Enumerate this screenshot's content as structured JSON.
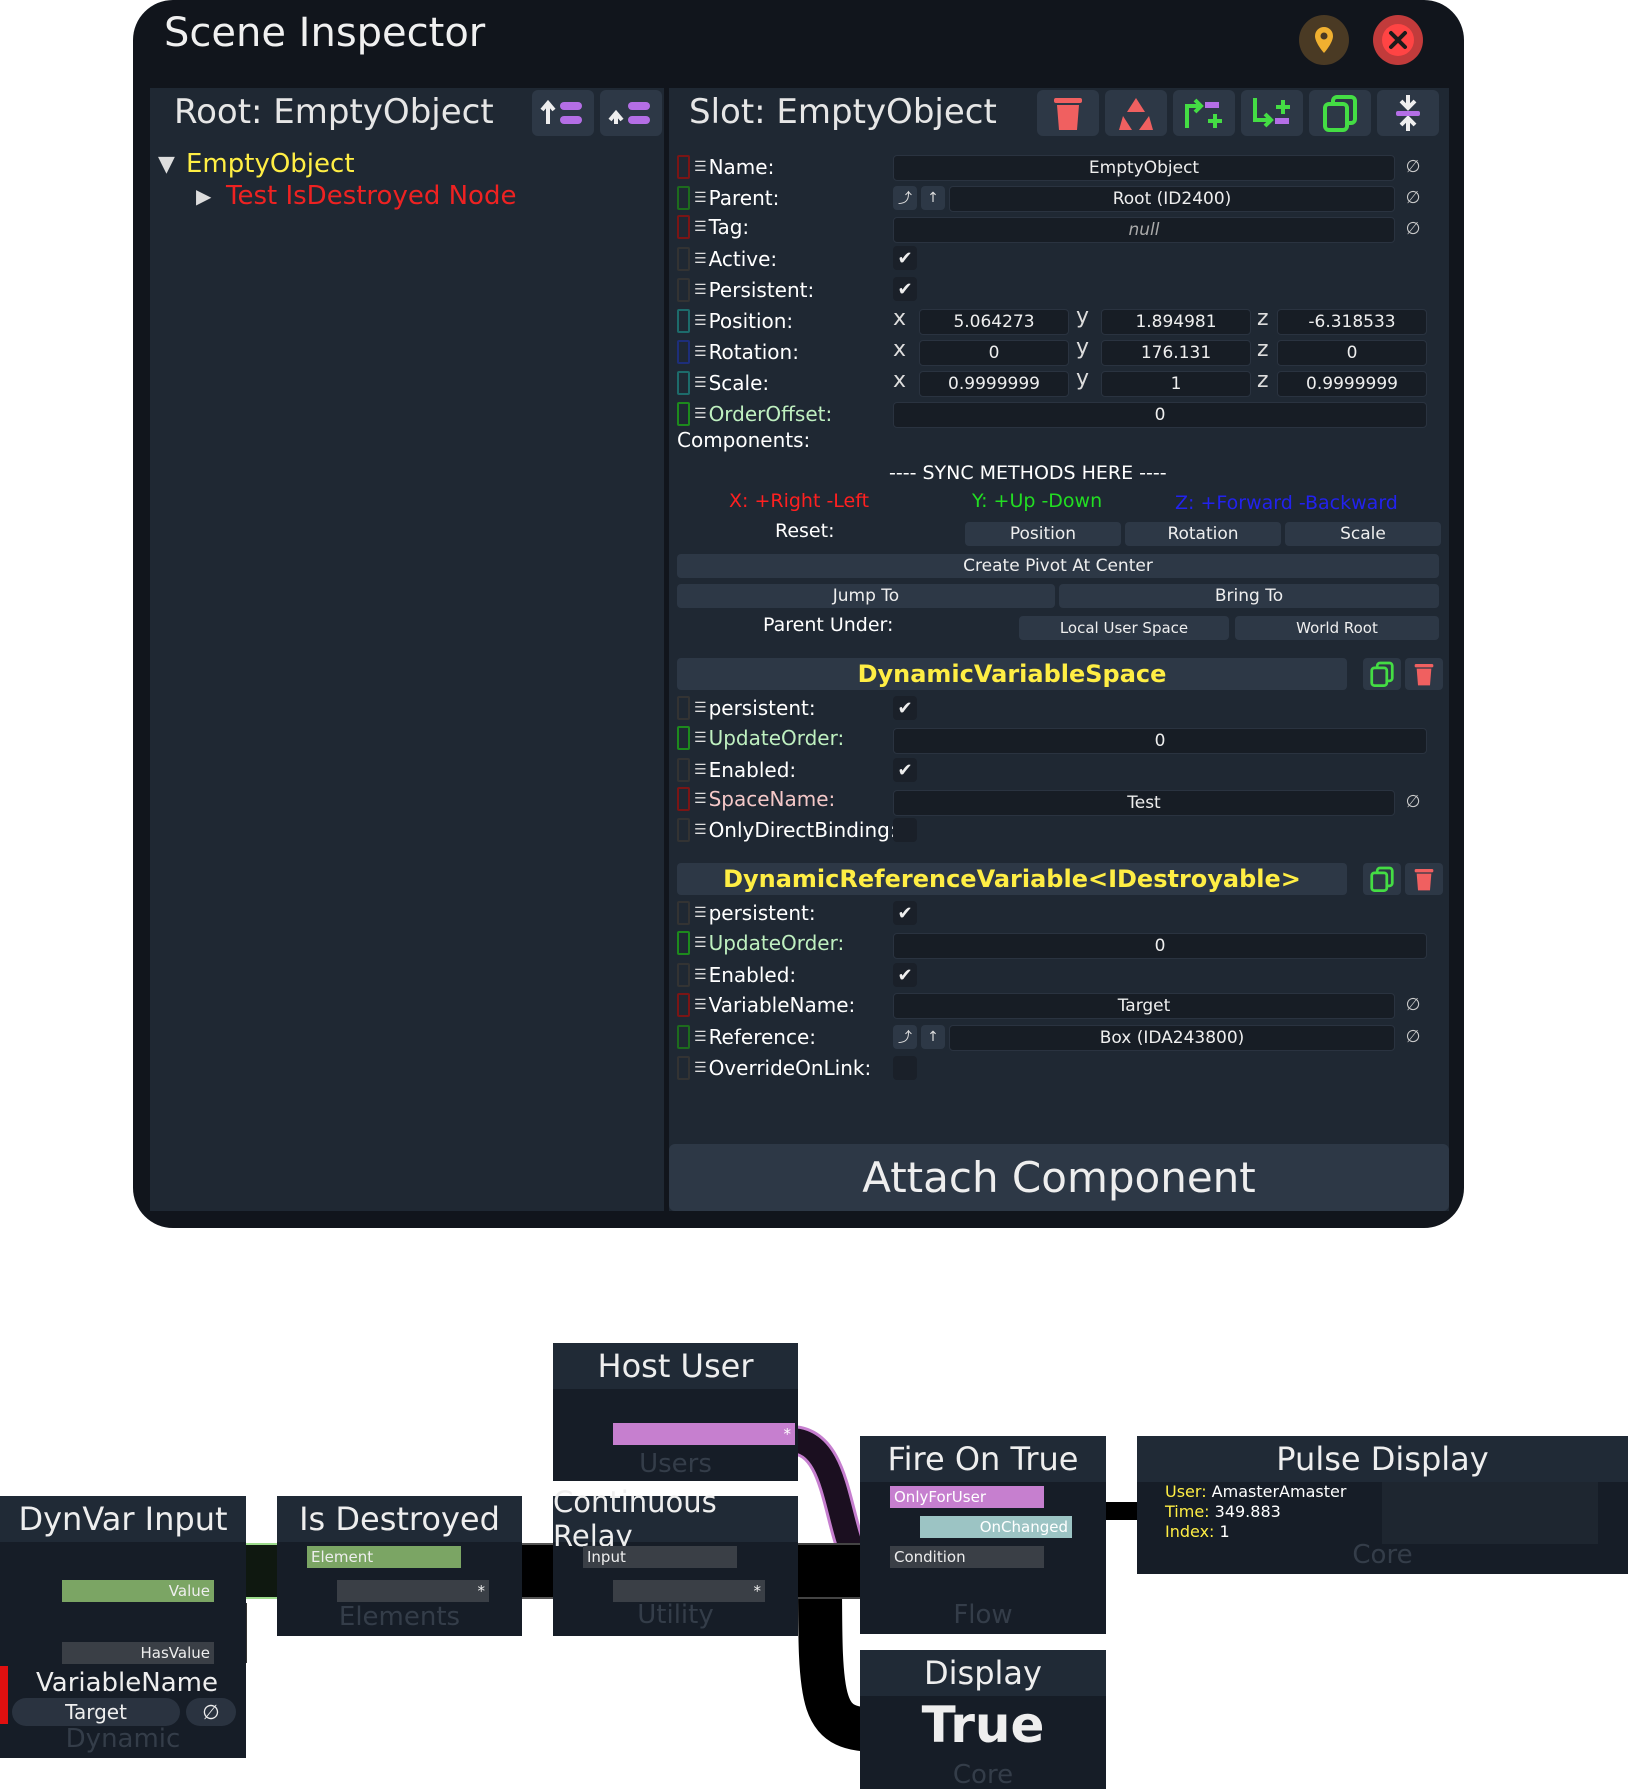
{
  "window": {
    "title": "Scene Inspector"
  },
  "hierarchy": {
    "root_label": "Root: EmptyObject",
    "nodes": [
      {
        "expander": "▼",
        "label": "EmptyObject",
        "color": "#ffee44"
      },
      {
        "expander": "▶",
        "label": "Test IsDestroyed Node",
        "color": "#ee2222"
      }
    ]
  },
  "slot": {
    "label": "Slot: EmptyObject",
    "fields": {
      "name_label": "Name:",
      "name_value": "EmptyObject",
      "parent_label": "Parent:",
      "parent_value": "Root (ID2400)",
      "tag_label": "Tag:",
      "tag_value": "null",
      "active_label": "Active:",
      "persistent_label": "Persistent:",
      "position_label": "Position:",
      "position": {
        "x": "5.064273",
        "y": "1.894981",
        "z": "-6.318533"
      },
      "rotation_label": "Rotation:",
      "rotation": {
        "x": "0",
        "y": "176.131",
        "z": "0"
      },
      "scale_label": "Scale:",
      "scale": {
        "x": "0.9999999",
        "y": "1",
        "z": "0.9999999"
      },
      "orderoffset_label": "OrderOffset:",
      "orderoffset_value": "0"
    },
    "axis": {
      "x": "x",
      "y": "y",
      "z": "z"
    },
    "components_label": "Components:",
    "check_glyph": "✔",
    "null_glyph": "∅",
    "up_glyph": "↑",
    "upleft_glyph": "⤴"
  },
  "sync": {
    "header": "---- SYNC METHODS HERE ----",
    "x_hint": "X: +Right -Left",
    "y_hint": "Y: +Up -Down",
    "z_hint": "Z: +Forward -Backward",
    "reset_label": "Reset:",
    "reset_position": "Position",
    "reset_rotation": "Rotation",
    "reset_scale": "Scale",
    "create_pivot": "Create Pivot At Center",
    "jump_to": "Jump To",
    "bring_to": "Bring To",
    "parent_under_label": "Parent Under:",
    "local_user_space": "Local User Space",
    "world_root": "World Root"
  },
  "components": [
    {
      "title": "DynamicVariableSpace",
      "persistent_label": "persistent:",
      "updateorder_label": "UpdateOrder:",
      "updateorder_value": "0",
      "enabled_label": "Enabled:",
      "spacename_label": "SpaceName:",
      "spacename_value": "Test",
      "onlydirect_label": "OnlyDirectBinding:"
    },
    {
      "title": "DynamicReferenceVariable<IDestroyable>",
      "persistent_label": "persistent:",
      "updateorder_label": "UpdateOrder:",
      "updateorder_value": "0",
      "enabled_label": "Enabled:",
      "varname_label": "VariableName:",
      "varname_value": "Target",
      "reference_label": "Reference:",
      "reference_value": "Box (IDA243800)",
      "override_label": "OverrideOnLink:"
    }
  ],
  "attach_label": "Attach Component",
  "graph": {
    "host_user": {
      "title": "Host User",
      "category": "Users"
    },
    "dynvar_input": {
      "title": "DynVar Input",
      "value_port": "Value",
      "hasvalue_port": "HasValue",
      "varname_title": "VariableName",
      "varname_value": "Target",
      "category": "Dynamic"
    },
    "is_destroyed": {
      "title": "Is Destroyed",
      "element_port": "Element",
      "category": "Elements"
    },
    "continuous_relay": {
      "title": "Continuous Relay",
      "input_port": "Input",
      "category": "Utility"
    },
    "fire_on_true": {
      "title": "Fire On True",
      "onlyforuser_port": "OnlyForUser",
      "onchanged_port": "OnChanged",
      "condition_port": "Condition",
      "category": "Flow"
    },
    "pulse_display": {
      "title": "Pulse Display",
      "user_label": "User:",
      "user_value": "AmasterAmaster",
      "time_label": "Time:",
      "time_value": "349.883",
      "index_label": "Index:",
      "index_value": "1",
      "category": "Core"
    },
    "display": {
      "title": "Display",
      "value": "True",
      "category": "Core"
    },
    "star": "*"
  },
  "colors": {
    "accent_yellow": "#ffee44",
    "destroyed_red": "#ee2222",
    "x_axis": "#ff2020",
    "y_axis": "#22dd22",
    "z_axis": "#2222ee",
    "user_port": "#c67fcf",
    "element_port": "#7ba564",
    "bool_port": "#7ba564",
    "impulse_port": "#9cc4c4"
  },
  "icons": [
    "pin-icon",
    "close-icon",
    "move-up-icon",
    "move-down-icon",
    "trash-icon",
    "recycle-icon",
    "add-parent-icon",
    "add-child-icon",
    "duplicate-icon",
    "collapse-icon",
    "check-icon",
    "null-icon"
  ]
}
